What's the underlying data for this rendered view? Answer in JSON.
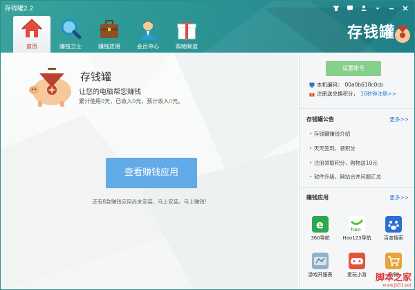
{
  "window": {
    "title": "存钱罐2.2"
  },
  "nav": {
    "tabs": [
      {
        "label": "首页",
        "icon": "home-icon",
        "active": true
      },
      {
        "label": "赚钱卫士",
        "icon": "magnifier-icon",
        "active": false
      },
      {
        "label": "赚钱应用",
        "icon": "briefcase-icon",
        "active": false
      },
      {
        "label": "会员中心",
        "icon": "user-icon",
        "active": false
      },
      {
        "label": "购物频道",
        "icon": "gift-icon",
        "active": false
      }
    ]
  },
  "brand": {
    "name": "存钱罐"
  },
  "main": {
    "app_name": "存钱罐",
    "slogan": "让您的电脑帮您赚钱",
    "stats": {
      "prefix": "累计使用",
      "days": "0",
      "days_unit": "天，已收入",
      "income": "0",
      "income_unit": "元，预计收入",
      "expected": "0",
      "expected_unit": "元。"
    },
    "cta_button": "查看赚钱应用",
    "hint": "还有8款赚钱应用尚未安装，马上安装，马上赚钱!"
  },
  "sidebar": {
    "settings_button": "设置账号",
    "machine_label": "本机编码：",
    "machine_code": "00a0b618c0cb",
    "register_text": "注册送兑换积分，",
    "register_link": "10秒钟注册>>",
    "notice": {
      "title": "存钱罐公告",
      "more": "更多>>",
      "items": [
        "存钱罐赚钱介绍",
        "天天签到，领积分",
        "注册领取积分，购物送10元",
        "软件升级，网站合并问题汇总"
      ]
    },
    "apps": {
      "title": "赚钱应用",
      "more": "更多>>",
      "items": [
        {
          "label": "360导航",
          "icon": "ie-icon",
          "color": "#2ea84a"
        },
        {
          "label": "Hao123导航",
          "icon": "hao123-icon",
          "color": "#5bbd3b"
        },
        {
          "label": "百度搜索",
          "icon": "baidu-icon",
          "color": "#2b6ed6"
        },
        {
          "label": "游戏开服表",
          "icon": "game-icon",
          "color": "#8fb2c9"
        },
        {
          "label": "爱玩小游",
          "icon": "gamepad-icon",
          "color": "#e2533a"
        },
        {
          "label": "购物",
          "icon": "cart-icon",
          "color": "#e8a33c"
        }
      ]
    }
  },
  "watermark": {
    "text": "脚本之家",
    "sub": "www.jb51.net"
  },
  "colors": {
    "header": "#2d9a97",
    "cta": "#63aae8",
    "settings_button": "#85d08a",
    "link": "#2b7bd0"
  }
}
